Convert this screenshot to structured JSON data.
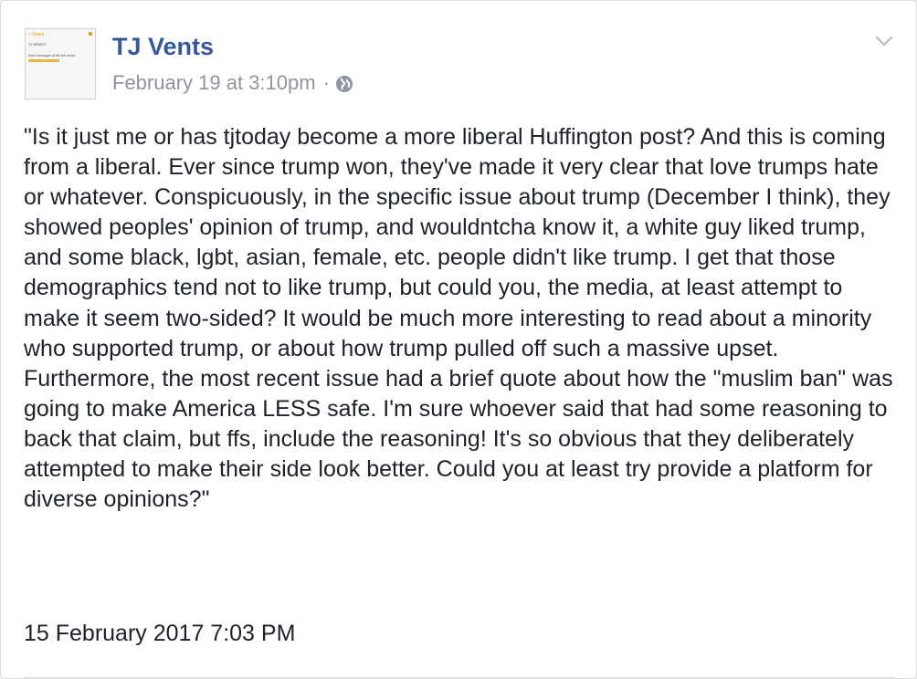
{
  "post": {
    "author": "TJ Vents",
    "timestamp": "February 19 at 3:10pm",
    "separator": "·",
    "privacy_icon": "globe-icon",
    "menu_icon": "chevron-down-icon",
    "body": "\"Is it just me or has tjtoday become a more liberal Huffington post? And this is coming from a liberal. Ever since trump won, they've made it very clear that love trumps hate or whatever. Conspicuously, in the specific issue about trump (December I think), they showed peoples' opinion of trump, and wouldntcha know it, a white guy liked trump, and some black, lgbt, asian, female, etc. people didn't like trump. I get that those demographics tend not to like trump, but could you, the media, at least attempt to make it seem two-sided? It would be much more interesting to read about a minority who supported trump, or about how trump pulled off such a massive upset. Furthermore, the most recent issue had a brief quote about how the \"muslim ban\" was going to make America LESS safe. I'm sure whoever said that had some reasoning to back that claim, but ffs, include the reasoning! It's so obvious that they deliberately attempted to make their side look better. Could you at least try provide a platform for diverse opinions?\"",
    "submitted_date": "15 February 2017 7:03 PM"
  },
  "avatar": {
    "back_label": "< Notes",
    "title": "TJ VENTS",
    "line": "Send messages at the link below:"
  },
  "colors": {
    "author_link": "#365899",
    "meta_text": "#90949c",
    "body_text": "#1d2129",
    "avatar_accent": "#e0a020"
  }
}
